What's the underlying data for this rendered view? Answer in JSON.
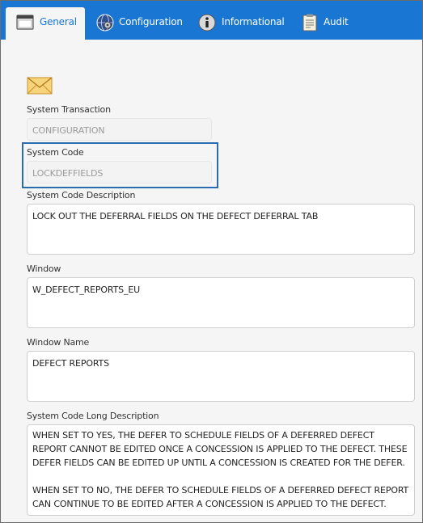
{
  "tabs": [
    {
      "label": "General",
      "icon": "window-icon",
      "active": true
    },
    {
      "label": "Configuration",
      "icon": "gear-globe-icon",
      "active": false
    },
    {
      "label": "Informational",
      "icon": "info-icon",
      "active": false
    },
    {
      "label": "Audit",
      "icon": "clipboard-icon",
      "active": false
    }
  ],
  "header_icon": "envelope-icon",
  "fields": {
    "system_transaction": {
      "label": "System Transaction",
      "value": "CONFIGURATION"
    },
    "system_code": {
      "label": "System Code",
      "value": "LOCKDEFFIELDS"
    },
    "system_code_description": {
      "label": "System Code Description",
      "value": "LOCK OUT THE DEFERRAL FIELDS ON THE DEFECT DEFERRAL TAB"
    },
    "window": {
      "label": "Window",
      "value": "W_DEFECT_REPORTS_EU"
    },
    "window_name": {
      "label": "Window Name",
      "value": "DEFECT REPORTS"
    },
    "long_description": {
      "label": "System Code Long Description",
      "paragraph_1": "WHEN SET TO YES, THE DEFER TO SCHEDULE FIELDS OF A DEFERRED DEFECT REPORT CANNOT BE EDITED ONCE A CONCESSION IS APPLIED TO THE DEFECT. THESE DEFER FIELDS CAN BE EDITED UP UNTIL A CONCESSION IS CREATED FOR THE DEFER.",
      "paragraph_2": "WHEN SET TO NO, THE DEFER TO SCHEDULE FIELDS OF A DEFERRED DEFECT REPORT CAN CONTINUE TO BE EDITED AFTER A CONCESSION IS APPLIED TO THE DEFECT."
    }
  },
  "colors": {
    "tabbar": "#1976d2",
    "highlight": "#2b6cb0",
    "background": "#f5f5f5"
  }
}
